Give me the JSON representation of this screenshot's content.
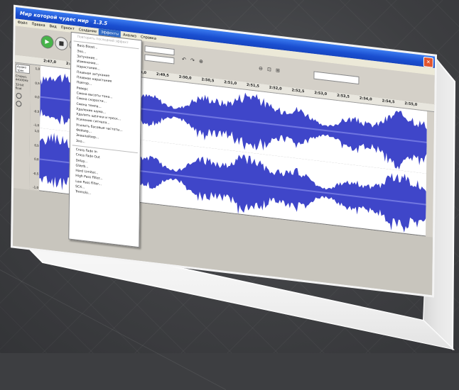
{
  "window": {
    "title": "Мир которой чудес мир",
    "title_suffix": "1.3.5",
    "close_glyph": "✕"
  },
  "menubar": {
    "items": [
      "Файл",
      "Правка",
      "Вид",
      "Проект",
      "Создание",
      "Эффекты",
      "Анализ",
      "Справка"
    ],
    "active_index": 5
  },
  "toolbar": {
    "play_glyph": "▶",
    "stop_glyph": "■",
    "rec_glyph": "●",
    "tool_glyphs": [
      "I",
      "↔",
      "✎",
      "✱",
      "✂",
      "⎘",
      "↶",
      "↷",
      "⊕",
      "⊖",
      "⊡",
      "⊞"
    ]
  },
  "ruler": {
    "labels": [
      "2:47,0",
      "2:47,5",
      "2:48,0",
      "2:48,5",
      "2:49,0",
      "2:49,5",
      "2:50,0",
      "2:50,5",
      "2:51,0",
      "2:51,5",
      "2:52,0",
      "2:52,5",
      "2:53,0",
      "2:53,5",
      "2:54,0",
      "2:54,5",
      "2:55,0"
    ]
  },
  "track": {
    "name": "Аудио трек",
    "info": [
      "Стерео, 44100Hz",
      "32-bit float"
    ],
    "scale_top": [
      "1,0",
      "0,5",
      "0,0",
      "-0,5",
      "-1,0"
    ],
    "scale_bottom": [
      "1,0",
      "0,5",
      "0,0",
      "-0,5",
      "-1,0"
    ]
  },
  "colors": {
    "wave": "#3f46c9",
    "menu_highlight": "#316ac5",
    "titlebar": "#1a4fd0"
  },
  "effects_menu": {
    "items": [
      {
        "label": "Повторить последний эффект",
        "disabled": true
      },
      {
        "sep": true
      },
      {
        "label": "Bass Boost..."
      },
      {
        "label": "Эхо..."
      },
      {
        "label": "Затухание..."
      },
      {
        "label": "Изменение..."
      },
      {
        "label": "Нарастание..."
      },
      {
        "label": "Плавное затухание"
      },
      {
        "label": "Плавное нарастание"
      },
      {
        "label": "Повтор..."
      },
      {
        "label": "Реверс"
      },
      {
        "label": "Смена высоты тона..."
      },
      {
        "label": "Смена скорости..."
      },
      {
        "label": "Смена темпа..."
      },
      {
        "label": "Удаление шума..."
      },
      {
        "label": "Удалить щелчки и треск..."
      },
      {
        "label": "Усиление сигнала..."
      },
      {
        "label": "Усилить басовые частоты..."
      },
      {
        "label": "Фейзер..."
      },
      {
        "label": "Эквалайзер..."
      },
      {
        "label": "Эхо..."
      },
      {
        "sep": true
      },
      {
        "label": "Cross Fade In"
      },
      {
        "label": "Cross Fade Out"
      },
      {
        "label": "Delay..."
      },
      {
        "label": "GVerb..."
      },
      {
        "label": "Hard Limiter..."
      },
      {
        "label": "High Pass Filter..."
      },
      {
        "label": "Low Pass Filter..."
      },
      {
        "label": "SC4..."
      },
      {
        "label": "Tremolo..."
      }
    ]
  }
}
